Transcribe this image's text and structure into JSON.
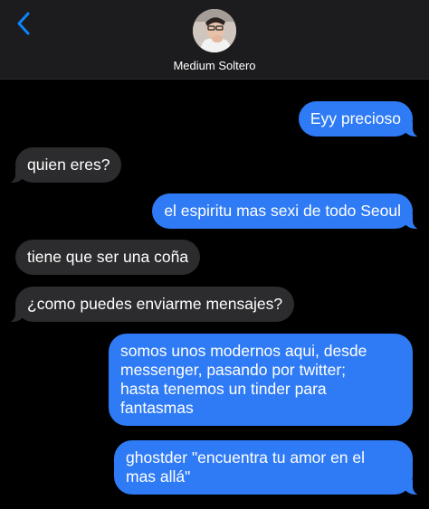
{
  "header": {
    "contact_name": "Medium Soltero",
    "back_icon": "chevron-left-icon",
    "accent": "#0a84ff"
  },
  "colors": {
    "outgoing": "#2f7bf5",
    "incoming": "#2c2c2e",
    "background": "#000000"
  },
  "messages": [
    {
      "direction": "outgoing",
      "text": "Eyy precioso"
    },
    {
      "direction": "incoming",
      "text": "quien eres?"
    },
    {
      "direction": "outgoing",
      "text": "el espiritu mas sexi de todo Seoul"
    },
    {
      "direction": "incoming",
      "text": "tiene que ser una coña"
    },
    {
      "direction": "incoming",
      "text": "¿como puedes enviarme mensajes?"
    },
    {
      "direction": "outgoing",
      "text": "somos unos modernos aqui, desde\nmessenger, pasando por twitter;\nhasta tenemos un tinder para\nfantasmas"
    },
    {
      "direction": "outgoing",
      "text": "ghostder \"encuentra tu amor en el\nmas allá\""
    }
  ]
}
